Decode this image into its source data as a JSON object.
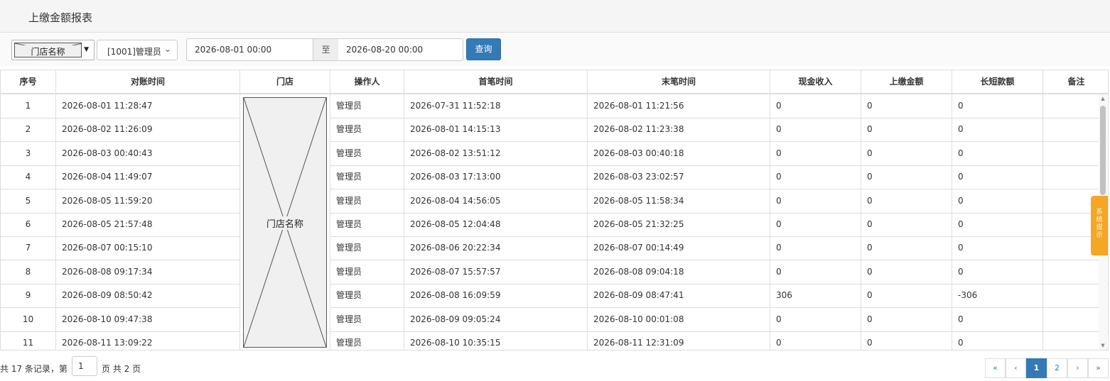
{
  "page": {
    "title": "上缴金额报表"
  },
  "filters": {
    "store_placeholder": "门店名称",
    "operator_value": "[1001]管理员",
    "date_start": "2026-08-01 00:00",
    "date_separator": "至",
    "date_end": "2026-08-20 00:00",
    "query_label": "查询"
  },
  "table": {
    "headers": [
      "序号",
      "对账时间",
      "门店",
      "操作人",
      "首笔时间",
      "末笔时间",
      "现金收入",
      "上缴金额",
      "长短款额",
      "备注"
    ],
    "store_placeholder": "门店名称",
    "rows": [
      [
        "1",
        "2026-08-01 11:28:47",
        "管理员",
        "2026-07-31 11:52:18",
        "2026-08-01 11:21:56",
        "0",
        "0",
        "0",
        ""
      ],
      [
        "2",
        "2026-08-02 11:26:09",
        "管理员",
        "2026-08-01 14:15:13",
        "2026-08-02 11:23:38",
        "0",
        "0",
        "0",
        ""
      ],
      [
        "3",
        "2026-08-03 00:40:43",
        "管理员",
        "2026-08-02 13:51:12",
        "2026-08-03 00:40:18",
        "0",
        "0",
        "0",
        ""
      ],
      [
        "4",
        "2026-08-04 11:49:07",
        "管理员",
        "2026-08-03 17:13:00",
        "2026-08-03 23:02:57",
        "0",
        "0",
        "0",
        ""
      ],
      [
        "5",
        "2026-08-05 11:59:20",
        "管理员",
        "2026-08-04 14:56:05",
        "2026-08-05 11:58:34",
        "0",
        "0",
        "0",
        ""
      ],
      [
        "6",
        "2026-08-05 21:57:48",
        "管理员",
        "2026-08-05 12:04:48",
        "2026-08-05 21:32:25",
        "0",
        "0",
        "0",
        ""
      ],
      [
        "7",
        "2026-08-07 00:15:10",
        "管理员",
        "2026-08-06 20:22:34",
        "2026-08-07 00:14:49",
        "0",
        "0",
        "0",
        ""
      ],
      [
        "8",
        "2026-08-08 09:17:34",
        "管理员",
        "2026-08-07 15:57:57",
        "2026-08-08 09:04:18",
        "0",
        "0",
        "0",
        ""
      ],
      [
        "9",
        "2026-08-09 08:50:42",
        "管理员",
        "2026-08-08 16:09:59",
        "2026-08-09 08:47:41",
        "306",
        "0",
        "-306",
        ""
      ],
      [
        "10",
        "2026-08-10 09:47:38",
        "管理员",
        "2026-08-09 09:05:24",
        "2026-08-10 00:01:08",
        "0",
        "0",
        "0",
        ""
      ],
      [
        "11",
        "2026-08-11 13:09:22",
        "管理员",
        "2026-08-10 10:35:15",
        "2026-08-11 12:31:09",
        "0",
        "0",
        "0",
        ""
      ]
    ]
  },
  "side_tab": {
    "label": "系统提示"
  },
  "footer": {
    "prefix": "共 17 条记录，第",
    "current_page": "1",
    "suffix": "页 共 2 页"
  },
  "pagination": {
    "first": "«",
    "prev": "‹",
    "pages": [
      "1",
      "2"
    ],
    "next": "›",
    "last": "»",
    "active_page": "1"
  },
  "colors": {
    "primary": "#337ab7",
    "tip": "#f5a623",
    "border": "#dddddd"
  }
}
